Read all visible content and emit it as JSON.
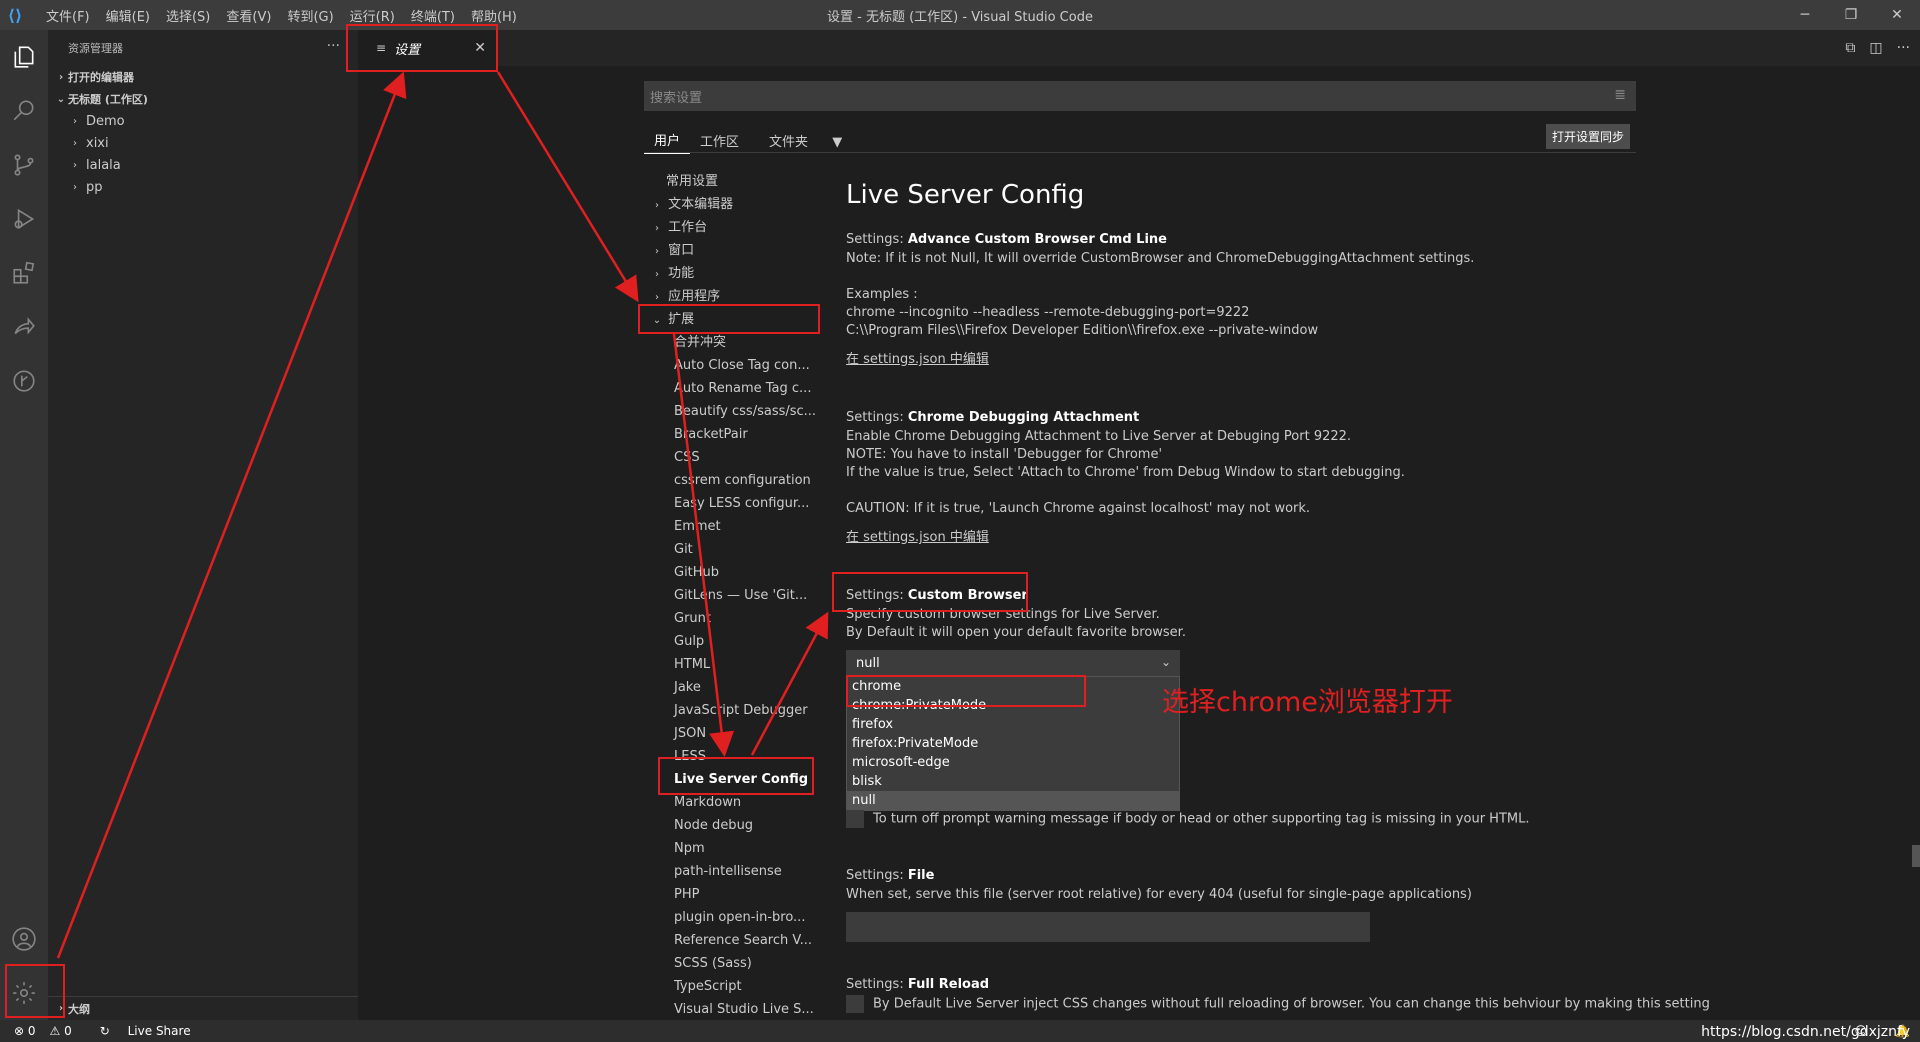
{
  "window": {
    "title": "设置 - 无标题 (工作区) - Visual Studio Code"
  },
  "menu": [
    "文件(F)",
    "编辑(E)",
    "选择(S)",
    "查看(V)",
    "转到(G)",
    "运行(R)",
    "终端(T)",
    "帮助(H)"
  ],
  "window_controls": {
    "minimize": "─",
    "restore": "❐",
    "close": "✕"
  },
  "sidebar": {
    "title": "资源管理器",
    "more": "···",
    "open_editors": "打开的编辑器",
    "workspace": "无标题 (工作区)",
    "folders": [
      "Demo",
      "xixi",
      "lalala",
      "pp"
    ],
    "outline": "大纲"
  },
  "tab": {
    "label": "设置",
    "icon": "≡",
    "close": "✕"
  },
  "editor_actions": [
    "⧉",
    "◫",
    "···"
  ],
  "settings": {
    "search_placeholder": "搜索设置",
    "scope_tabs": [
      "用户",
      "工作区",
      "文件夹"
    ],
    "sync_button": "打开设置同步",
    "toc": {
      "top": [
        "常用设置",
        "文本编辑器",
        "工作台",
        "窗口",
        "功能",
        "应用程序"
      ],
      "expanded": "扩展",
      "extensions": [
        "合并冲突",
        "Auto Close Tag con...",
        "Auto Rename Tag c...",
        "Beautify css/sass/sc...",
        "BracketPair",
        "CSS",
        "cssrem configuration",
        "Easy LESS configur...",
        "Emmet",
        "Git",
        "GitHub",
        "GitLens — Use 'Git...",
        "Grunt",
        "Gulp",
        "HTML",
        "Jake",
        "JavaScript Debugger",
        "JSON",
        "LESS",
        "Live Server Config",
        "Markdown",
        "Node debug",
        "Npm",
        "path-intellisense",
        "PHP",
        "plugin open-in-bro...",
        "Reference Search V...",
        "SCSS (Sass)",
        "TypeScript",
        "Visual Studio Live S..."
      ]
    },
    "heading": "Live Server Config",
    "items": [
      {
        "prefix": "Settings: ",
        "name": "Advance Custom Browser Cmd Line",
        "lines": [
          "Note: If it is not Null, It will override CustomBrowser and ChromeDebuggingAttachment settings.",
          "",
          "Examples :",
          "chrome --incognito --headless --remote-debugging-port=9222",
          "C:\\\\Program Files\\\\Firefox Developer Edition\\\\firefox.exe --private-window"
        ],
        "link": "在 settings.json 中编辑"
      },
      {
        "prefix": "Settings: ",
        "name": "Chrome Debugging Attachment",
        "lines": [
          "Enable Chrome Debugging Attachment to Live Server at Debuging Port 9222.",
          "NOTE: You have to install 'Debugger for Chrome'",
          "If the value is true, Select 'Attach to Chrome' from Debug Window to start debugging.",
          "",
          "CAUTION: If it is true, 'Launch Chrome against localhost' may not work."
        ],
        "link": "在 settings.json 中编辑"
      },
      {
        "prefix": "Settings: ",
        "name": "Custom Browser",
        "lines": [
          "Specify custom browser settings for Live Server.",
          "By Default it will open your default favorite browser."
        ],
        "selected": "null",
        "options": [
          "chrome",
          "chrome:PrivateMode",
          "firefox",
          "firefox:PrivateMode",
          "microsoft-edge",
          "blisk",
          "null"
        ]
      },
      {
        "checkbox_text": "To turn off prompt warning message if body or head or other supporting tag is missing in your HTML."
      },
      {
        "prefix": "Settings: ",
        "name": "File",
        "lines": [
          "When set, serve this file (server root relative) for every 404 (useful for single-page applications)"
        ]
      },
      {
        "prefix": "Settings: ",
        "name": "Full Reload",
        "checkbox_text": "By Default Live Server inject CSS changes without full reloading of browser. You can change this behviour by making this setting"
      }
    ]
  },
  "annotation": {
    "text": "选择chrome浏览器打开",
    "color": "#e02020"
  },
  "status": {
    "errors": "⊗ 0",
    "warnings": "⚠ 0",
    "live_share": "Live Share"
  },
  "watermark": "https://blog.csdn.net/gdxjznfy"
}
